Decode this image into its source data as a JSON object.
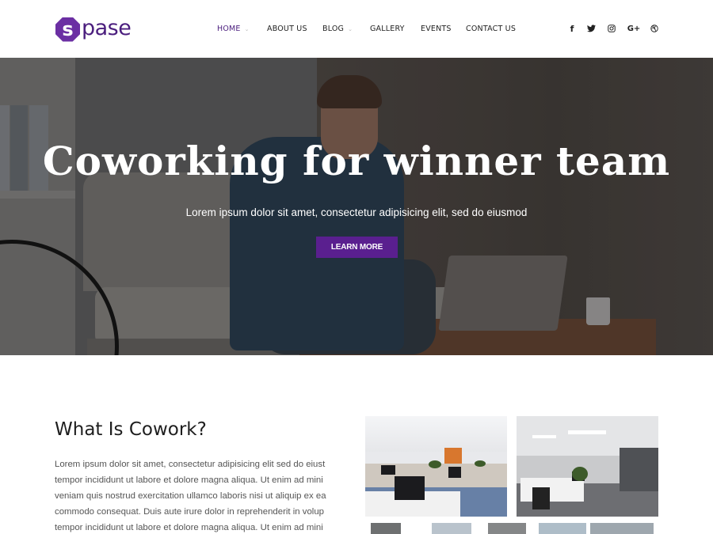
{
  "header": {
    "logo": {
      "badge_letter": "s",
      "text": "pase"
    },
    "nav": [
      {
        "label": "HOME",
        "active": true,
        "has_dropdown": true
      },
      {
        "label": "ABOUT US",
        "active": false,
        "has_dropdown": false
      },
      {
        "label": "BLOG",
        "active": false,
        "has_dropdown": true
      },
      {
        "label": "GALLERY",
        "active": false,
        "has_dropdown": false
      },
      {
        "label": "EVENTS",
        "active": false,
        "has_dropdown": false
      },
      {
        "label": "CONTACT US",
        "active": false,
        "has_dropdown": false
      }
    ],
    "caret_glyph": "⌄",
    "social": [
      {
        "name": "facebook",
        "glyph": "f"
      },
      {
        "name": "twitter",
        "glyph": "🐦"
      },
      {
        "name": "instagram",
        "glyph": "◎"
      },
      {
        "name": "google-plus",
        "glyph": "G+"
      },
      {
        "name": "dribbble",
        "glyph": "⊛"
      }
    ]
  },
  "hero": {
    "title": "Coworking for winner team",
    "subtitle": "Lorem ipsum dolor sit amet, consectetur adipisicing elit, sed do eiusmod",
    "button_label": "LEARN MORE"
  },
  "about": {
    "title": "What Is Cowork?",
    "lines": [
      "Lorem ipsum dolor sit amet, consectetur adipisicing elit sed do eiust",
      "tempor incididunt ut labore et dolore magna aliqua. Ut enim ad mini",
      "veniam quis nostrud exercitation ullamco laboris nisi ut aliquip ex ea",
      "commodo consequat. Duis aute irure dolor in reprehenderit in volup",
      "tempor incididunt ut labore et dolore magna aliqua. Ut enim ad mini"
    ]
  },
  "colors": {
    "brand": "#4b1e7e",
    "button": "#5a1f8f",
    "text_dark": "#1e1e1e",
    "text_body": "#555555"
  }
}
